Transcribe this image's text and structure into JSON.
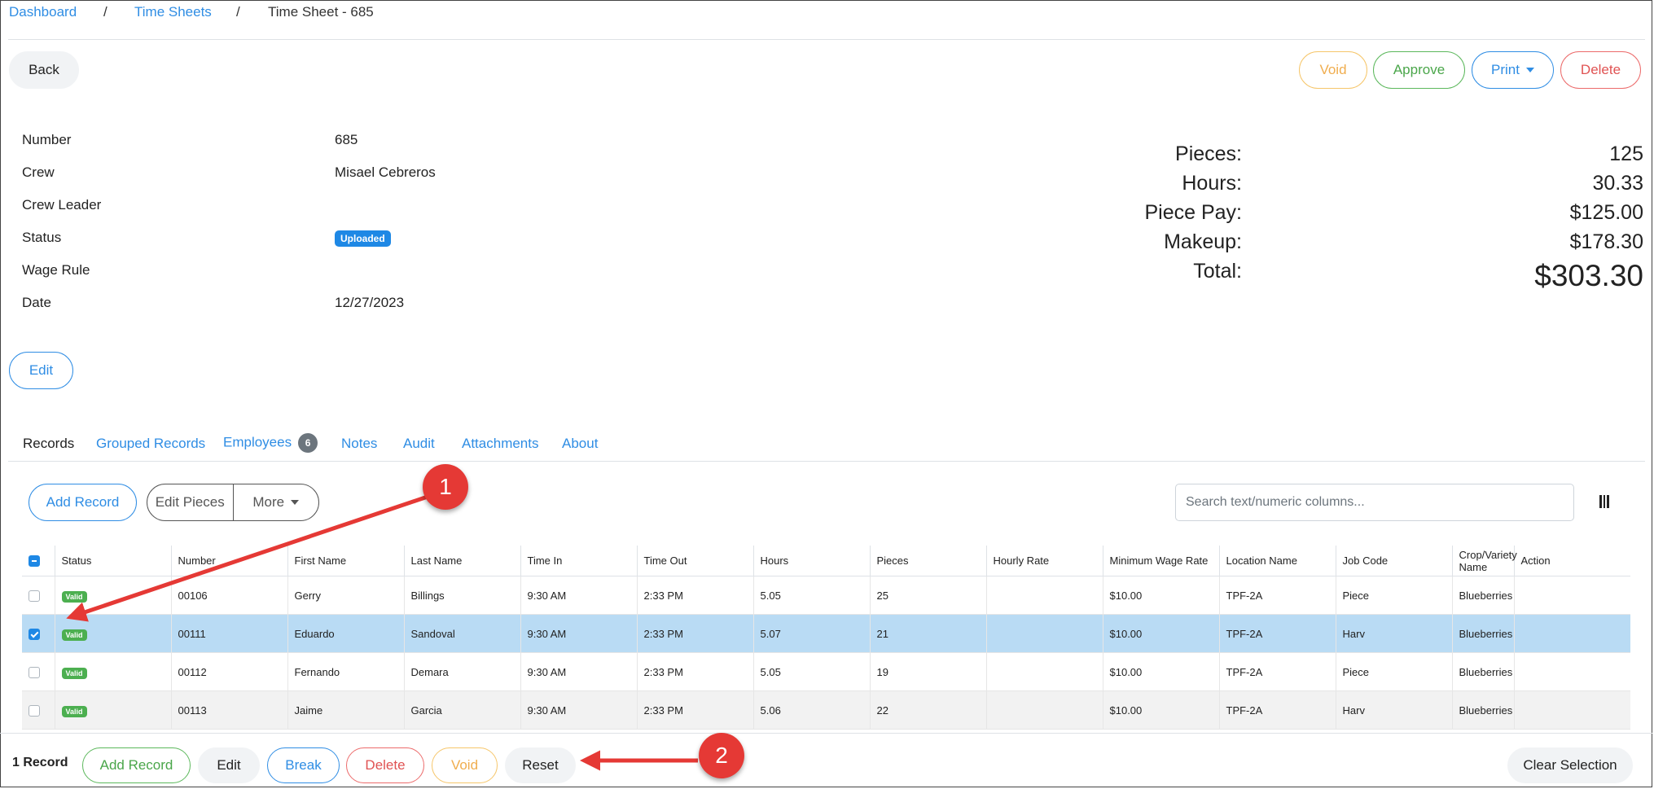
{
  "breadcrumb": {
    "dashboard": "Dashboard",
    "sep": "/",
    "time_sheets": "Time Sheets",
    "current": "Time Sheet - 685"
  },
  "header": {
    "back": "Back",
    "void": "Void",
    "approve": "Approve",
    "print": "Print",
    "delete": "Delete"
  },
  "info": {
    "number_label": "Number",
    "number": "685",
    "crew_label": "Crew",
    "crew": "Misael Cebreros",
    "crew_leader_label": "Crew Leader",
    "status_label": "Status",
    "status": "Uploaded",
    "wage_rule_label": "Wage Rule",
    "date_label": "Date",
    "date": "12/27/2023",
    "edit": "Edit"
  },
  "summary": {
    "pieces_label": "Pieces:",
    "pieces": "125",
    "hours_label": "Hours:",
    "hours": "30.33",
    "piece_pay_label": "Piece Pay:",
    "piece_pay": "$125.00",
    "makeup_label": "Makeup:",
    "makeup": "$178.30",
    "total_label": "Total:",
    "total": "$303.30"
  },
  "tabs": {
    "records": "Records",
    "grouped": "Grouped Records",
    "employees": "Employees",
    "employees_count": "6",
    "notes": "Notes",
    "audit": "Audit",
    "attachments": "Attachments",
    "about": "About"
  },
  "toolbar": {
    "add_record": "Add Record",
    "edit_pieces": "Edit Pieces",
    "more": "More",
    "search_placeholder": "Search text/numeric columns..."
  },
  "table": {
    "columns": [
      "Status",
      "Number",
      "First Name",
      "Last Name",
      "Time In",
      "Time Out",
      "Hours",
      "Pieces",
      "Hourly Rate",
      "Minimum Wage Rate",
      "Location Name",
      "Job Code",
      "Crop/Variety Name",
      "Action"
    ],
    "rows": [
      {
        "status": "Valid",
        "number": "00106",
        "first": "Gerry",
        "last": "Billings",
        "time_in": "9:30 AM",
        "time_out": "2:33 PM",
        "hours": "5.05",
        "pieces": "25",
        "hourly": "",
        "min_wage": "$10.00",
        "location": "TPF-2A",
        "job": "Piece",
        "crop": "Blueberries",
        "selected": false
      },
      {
        "status": "Valid",
        "number": "00111",
        "first": "Eduardo",
        "last": "Sandoval",
        "time_in": "9:30 AM",
        "time_out": "2:33 PM",
        "hours": "5.07",
        "pieces": "21",
        "hourly": "",
        "min_wage": "$10.00",
        "location": "TPF-2A",
        "job": "Harv",
        "crop": "Blueberries",
        "selected": true
      },
      {
        "status": "Valid",
        "number": "00112",
        "first": "Fernando",
        "last": "Demara",
        "time_in": "9:30 AM",
        "time_out": "2:33 PM",
        "hours": "5.05",
        "pieces": "19",
        "hourly": "",
        "min_wage": "$10.00",
        "location": "TPF-2A",
        "job": "Piece",
        "crop": "Blueberries",
        "selected": false
      },
      {
        "status": "Valid",
        "number": "00113",
        "first": "Jaime",
        "last": "Garcia",
        "time_in": "9:30 AM",
        "time_out": "2:33 PM",
        "hours": "5.06",
        "pieces": "22",
        "hourly": "",
        "min_wage": "$10.00",
        "location": "TPF-2A",
        "job": "Harv",
        "crop": "Blueberries",
        "selected": false
      }
    ]
  },
  "bottom_bar": {
    "count": "1 Record",
    "add_record": "Add Record",
    "edit": "Edit",
    "break": "Break",
    "delete": "Delete",
    "void": "Void",
    "reset": "Reset",
    "clear_selection": "Clear Selection"
  },
  "annotations": {
    "callout_1": "1",
    "callout_2": "2"
  },
  "colors": {
    "primary": "#2f8de4",
    "success": "#4caf50",
    "warning": "#f0ad4e",
    "danger": "#e05353",
    "selected_row": "#b9dbf4",
    "callout": "#e53935"
  }
}
